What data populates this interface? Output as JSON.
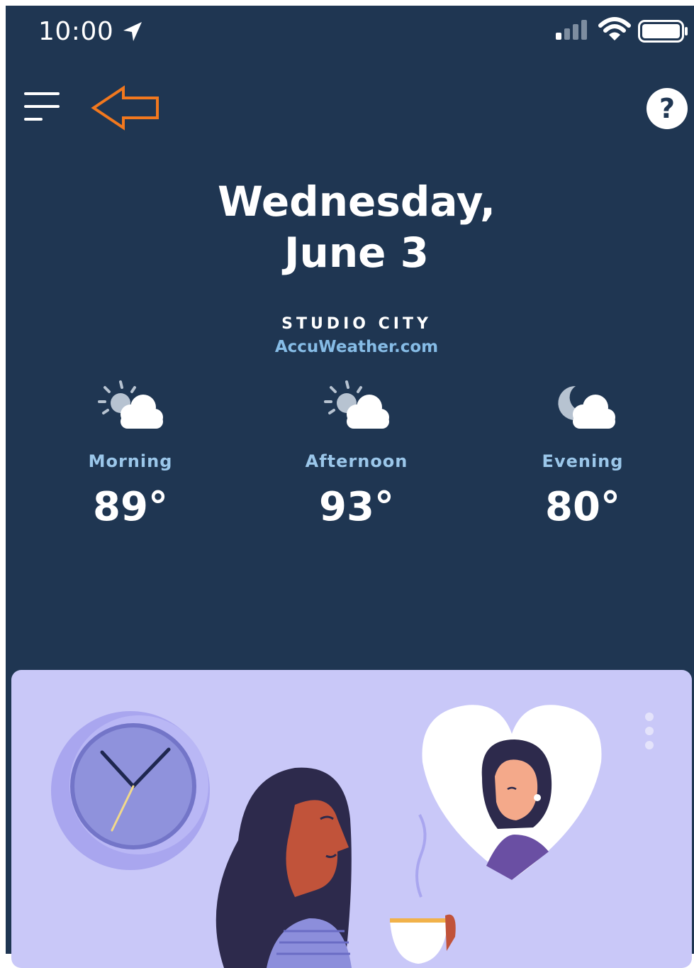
{
  "status_bar": {
    "time": "10:00"
  },
  "header": {
    "help_label": "?"
  },
  "date": {
    "line1": "Wednesday,",
    "line2": "June 3"
  },
  "location": {
    "city": "STUDIO CITY",
    "source": "AccuWeather.com"
  },
  "forecast": [
    {
      "period": "Morning",
      "temp": "89°",
      "icon": "partly-cloudy-day-icon"
    },
    {
      "period": "Afternoon",
      "temp": "93°",
      "icon": "partly-cloudy-day-icon"
    },
    {
      "period": "Evening",
      "temp": "80°",
      "icon": "partly-cloudy-night-icon"
    }
  ],
  "colors": {
    "background": "#1f3652",
    "accent_orange": "#f2781e",
    "period_label": "#9bc7ea",
    "source_link": "#86bce6",
    "card_background": "#c9c8f8"
  }
}
